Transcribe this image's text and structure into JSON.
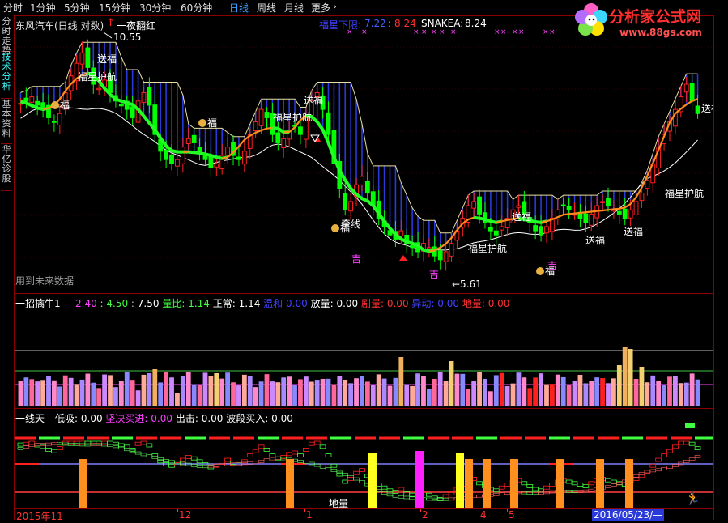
{
  "tabs": [
    "分时",
    "1分钟",
    "5分钟",
    "15分钟",
    "30分钟",
    "60分钟",
    "日线",
    "周线",
    "月线",
    "更多"
  ],
  "tabs_more_arrow": "›",
  "active_tab": 6,
  "left_tabs": [
    "分时走势",
    "技术分析",
    "基本资料",
    "华亿诊股"
  ],
  "logo": {
    "text": "分析家公式网",
    "url": "www.88gs.com"
  },
  "main": {
    "title": "东风汽车(日线 对数)",
    "signal": "一夜翻红",
    "future_note": "用到未来数据",
    "readout": {
      "label1": "福星下限:",
      "v1": "7.22",
      "v2": "8.24",
      "label2": "SNAKEA:",
      "v3": "8.24"
    },
    "high_label": "10.55",
    "low_label": "5.61",
    "annotations": {
      "songfu": "送福",
      "fuxing": "福星护航",
      "fu": "福",
      "fu_qian": "吉",
      "qianxian": "牵线"
    },
    "marks": "×  ×"
  },
  "mid": {
    "title": "一招擒牛1",
    "values": [
      {
        "label": "",
        "value": "2.40",
        "color": "#ff40ff"
      },
      {
        "label": "",
        "value": "4.50",
        "color": "#40ff40"
      },
      {
        "label": "",
        "value": "7.50",
        "color": "#ffffff"
      },
      {
        "label": "量比:",
        "value": "1.14",
        "color": "#40ff40"
      },
      {
        "label": "正常:",
        "value": "1.14",
        "color": "#ffffff"
      },
      {
        "label": "温和",
        "value": "0.00",
        "color": "#4040ff"
      },
      {
        "label": "放量:",
        "value": "0.00",
        "color": "#ffffff"
      },
      {
        "label": "剧量:",
        "value": "0.00",
        "color": "#ff3030"
      },
      {
        "label": "异动:",
        "value": "0.00",
        "color": "#4040ff"
      },
      {
        "label": "地量:",
        "value": "0.00",
        "color": "#ff3030"
      }
    ]
  },
  "low": {
    "title": "一线天",
    "values": [
      {
        "label": "低吸:",
        "value": "0.00",
        "color": "#ffffff"
      },
      {
        "label": "坚决买进:",
        "value": "0.00",
        "color": "#ff40ff"
      },
      {
        "label": "出击:",
        "value": "0.00",
        "color": "#ffffff"
      },
      {
        "label": "波段买入:",
        "value": "0.00",
        "color": "#ffffff"
      }
    ],
    "bottom_label": "地量"
  },
  "date_axis": {
    "labels": [
      "2015年11",
      "12",
      "1",
      "2",
      "4",
      "5"
    ],
    "cursor_date": "2016/05/23/—"
  },
  "chart_data": {
    "type": "candlestick",
    "title": "东风汽车(日线 对数)",
    "annotated_high": 10.55,
    "annotated_low": 5.61,
    "readout": {
      "福星下限": 7.22,
      "secondary": 8.24,
      "SNAKEA": 8.24
    },
    "close_series": [
      9.35,
      9.4,
      9.5,
      9.3,
      9.2,
      9.0,
      8.9,
      9.1,
      9.6,
      10.0,
      10.3,
      10.55,
      10.2,
      9.8,
      9.7,
      9.9,
      9.6,
      9.4,
      9.3,
      9.2,
      9.0,
      9.4,
      9.6,
      9.3,
      8.6,
      8.2,
      8.0,
      7.9,
      8.0,
      8.3,
      8.5,
      8.4,
      8.2,
      8.0,
      7.8,
      7.9,
      8.1,
      8.3,
      8.1,
      8.0,
      8.2,
      8.6,
      8.9,
      9.2,
      9.0,
      8.6,
      8.4,
      8.5,
      8.7,
      8.8,
      8.6,
      9.0,
      9.4,
      9.6,
      9.2,
      8.6,
      7.9,
      7.3,
      6.8,
      7.0,
      7.4,
      7.6,
      7.2,
      6.9,
      6.6,
      6.4,
      6.2,
      6.1,
      6.3,
      6.0,
      5.9,
      5.8,
      6.0,
      5.9,
      5.7,
      5.61,
      5.8,
      6.0,
      6.3,
      6.6,
      6.9,
      7.0,
      6.7,
      6.5,
      6.3,
      6.2,
      6.4,
      6.6,
      6.8,
      6.9,
      6.7,
      6.5,
      6.3,
      6.2,
      6.4,
      6.6,
      6.8,
      6.9,
      6.8,
      6.7,
      6.6,
      6.5,
      6.7,
      6.9,
      7.0,
      6.9,
      6.8,
      6.7,
      6.6,
      6.8,
      7.0,
      7.2,
      7.5,
      7.9,
      8.3,
      8.6,
      8.9,
      9.2,
      9.5,
      9.8,
      9.4,
      9.1
    ]
  },
  "colors": {
    "up": "#ff2020",
    "down": "#00ff00",
    "ma_green": "#22ff22",
    "ma_orange": "#ff8c1a",
    "ma_white": "#ffffff",
    "ma_yellow": "#e8e0a0",
    "blue_fill": "#2a3ad8",
    "axis_red": "#8b0000",
    "tab_active": "#40a0ff"
  }
}
